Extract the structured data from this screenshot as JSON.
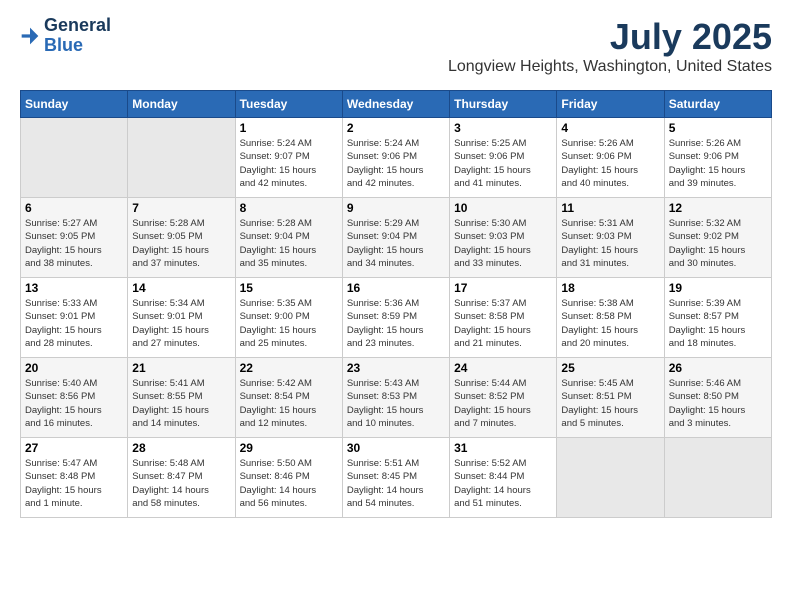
{
  "header": {
    "logo_line1": "General",
    "logo_line2": "Blue",
    "title": "July 2025",
    "subtitle": "Longview Heights, Washington, United States"
  },
  "calendar": {
    "days_of_week": [
      "Sunday",
      "Monday",
      "Tuesday",
      "Wednesday",
      "Thursday",
      "Friday",
      "Saturday"
    ],
    "weeks": [
      [
        {
          "day": "",
          "info": ""
        },
        {
          "day": "",
          "info": ""
        },
        {
          "day": "1",
          "info": "Sunrise: 5:24 AM\nSunset: 9:07 PM\nDaylight: 15 hours\nand 42 minutes."
        },
        {
          "day": "2",
          "info": "Sunrise: 5:24 AM\nSunset: 9:06 PM\nDaylight: 15 hours\nand 42 minutes."
        },
        {
          "day": "3",
          "info": "Sunrise: 5:25 AM\nSunset: 9:06 PM\nDaylight: 15 hours\nand 41 minutes."
        },
        {
          "day": "4",
          "info": "Sunrise: 5:26 AM\nSunset: 9:06 PM\nDaylight: 15 hours\nand 40 minutes."
        },
        {
          "day": "5",
          "info": "Sunrise: 5:26 AM\nSunset: 9:06 PM\nDaylight: 15 hours\nand 39 minutes."
        }
      ],
      [
        {
          "day": "6",
          "info": "Sunrise: 5:27 AM\nSunset: 9:05 PM\nDaylight: 15 hours\nand 38 minutes."
        },
        {
          "day": "7",
          "info": "Sunrise: 5:28 AM\nSunset: 9:05 PM\nDaylight: 15 hours\nand 37 minutes."
        },
        {
          "day": "8",
          "info": "Sunrise: 5:28 AM\nSunset: 9:04 PM\nDaylight: 15 hours\nand 35 minutes."
        },
        {
          "day": "9",
          "info": "Sunrise: 5:29 AM\nSunset: 9:04 PM\nDaylight: 15 hours\nand 34 minutes."
        },
        {
          "day": "10",
          "info": "Sunrise: 5:30 AM\nSunset: 9:03 PM\nDaylight: 15 hours\nand 33 minutes."
        },
        {
          "day": "11",
          "info": "Sunrise: 5:31 AM\nSunset: 9:03 PM\nDaylight: 15 hours\nand 31 minutes."
        },
        {
          "day": "12",
          "info": "Sunrise: 5:32 AM\nSunset: 9:02 PM\nDaylight: 15 hours\nand 30 minutes."
        }
      ],
      [
        {
          "day": "13",
          "info": "Sunrise: 5:33 AM\nSunset: 9:01 PM\nDaylight: 15 hours\nand 28 minutes."
        },
        {
          "day": "14",
          "info": "Sunrise: 5:34 AM\nSunset: 9:01 PM\nDaylight: 15 hours\nand 27 minutes."
        },
        {
          "day": "15",
          "info": "Sunrise: 5:35 AM\nSunset: 9:00 PM\nDaylight: 15 hours\nand 25 minutes."
        },
        {
          "day": "16",
          "info": "Sunrise: 5:36 AM\nSunset: 8:59 PM\nDaylight: 15 hours\nand 23 minutes."
        },
        {
          "day": "17",
          "info": "Sunrise: 5:37 AM\nSunset: 8:58 PM\nDaylight: 15 hours\nand 21 minutes."
        },
        {
          "day": "18",
          "info": "Sunrise: 5:38 AM\nSunset: 8:58 PM\nDaylight: 15 hours\nand 20 minutes."
        },
        {
          "day": "19",
          "info": "Sunrise: 5:39 AM\nSunset: 8:57 PM\nDaylight: 15 hours\nand 18 minutes."
        }
      ],
      [
        {
          "day": "20",
          "info": "Sunrise: 5:40 AM\nSunset: 8:56 PM\nDaylight: 15 hours\nand 16 minutes."
        },
        {
          "day": "21",
          "info": "Sunrise: 5:41 AM\nSunset: 8:55 PM\nDaylight: 15 hours\nand 14 minutes."
        },
        {
          "day": "22",
          "info": "Sunrise: 5:42 AM\nSunset: 8:54 PM\nDaylight: 15 hours\nand 12 minutes."
        },
        {
          "day": "23",
          "info": "Sunrise: 5:43 AM\nSunset: 8:53 PM\nDaylight: 15 hours\nand 10 minutes."
        },
        {
          "day": "24",
          "info": "Sunrise: 5:44 AM\nSunset: 8:52 PM\nDaylight: 15 hours\nand 7 minutes."
        },
        {
          "day": "25",
          "info": "Sunrise: 5:45 AM\nSunset: 8:51 PM\nDaylight: 15 hours\nand 5 minutes."
        },
        {
          "day": "26",
          "info": "Sunrise: 5:46 AM\nSunset: 8:50 PM\nDaylight: 15 hours\nand 3 minutes."
        }
      ],
      [
        {
          "day": "27",
          "info": "Sunrise: 5:47 AM\nSunset: 8:48 PM\nDaylight: 15 hours\nand 1 minute."
        },
        {
          "day": "28",
          "info": "Sunrise: 5:48 AM\nSunset: 8:47 PM\nDaylight: 14 hours\nand 58 minutes."
        },
        {
          "day": "29",
          "info": "Sunrise: 5:50 AM\nSunset: 8:46 PM\nDaylight: 14 hours\nand 56 minutes."
        },
        {
          "day": "30",
          "info": "Sunrise: 5:51 AM\nSunset: 8:45 PM\nDaylight: 14 hours\nand 54 minutes."
        },
        {
          "day": "31",
          "info": "Sunrise: 5:52 AM\nSunset: 8:44 PM\nDaylight: 14 hours\nand 51 minutes."
        },
        {
          "day": "",
          "info": ""
        },
        {
          "day": "",
          "info": ""
        }
      ]
    ]
  }
}
